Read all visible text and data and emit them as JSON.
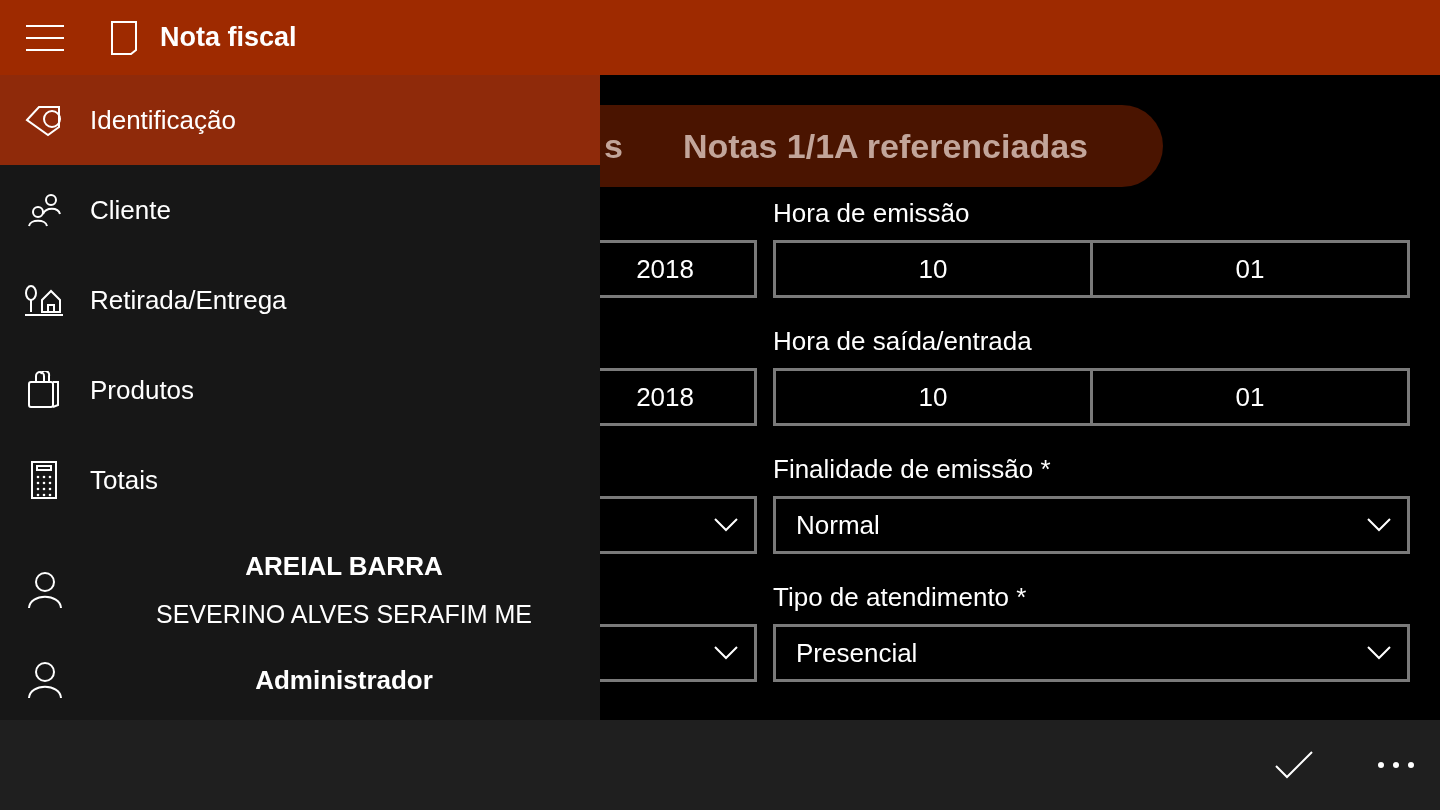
{
  "app_bar": {
    "title": "Nota fiscal"
  },
  "tabs": [
    {
      "label": "s"
    },
    {
      "label": "Notas 1/1A referenciadas"
    }
  ],
  "form": {
    "rows": [
      {
        "left": {
          "kind": "date",
          "value": "2018"
        },
        "right": {
          "label": "Hora de emissão",
          "kind": "time",
          "hour": "10",
          "minute": "01"
        }
      },
      {
        "left": {
          "kind": "date",
          "value": "2018"
        },
        "right": {
          "label": "Hora de saída/entrada",
          "kind": "time",
          "hour": "10",
          "minute": "01"
        }
      },
      {
        "left": {
          "kind": "select"
        },
        "right": {
          "label": "Finalidade de emissão *",
          "kind": "select",
          "value": "Normal"
        }
      },
      {
        "left": {
          "kind": "select"
        },
        "right": {
          "label": "Tipo de atendimento *",
          "kind": "select",
          "value": "Presencial"
        }
      }
    ]
  },
  "nav": {
    "items": [
      {
        "label": "Identificação",
        "kind": "tag",
        "selected": true
      },
      {
        "label": "Cliente",
        "kind": "people",
        "selected": false
      },
      {
        "label": "Retirada/Entrega",
        "kind": "home",
        "selected": false
      },
      {
        "label": "Produtos",
        "kind": "bag",
        "selected": false
      },
      {
        "label": "Totais",
        "kind": "calculator",
        "selected": false
      }
    ],
    "account": {
      "company": "AREIAL BARRA",
      "owner": "SEVERINO ALVES SERAFIM ME",
      "role": "Administrador"
    }
  }
}
